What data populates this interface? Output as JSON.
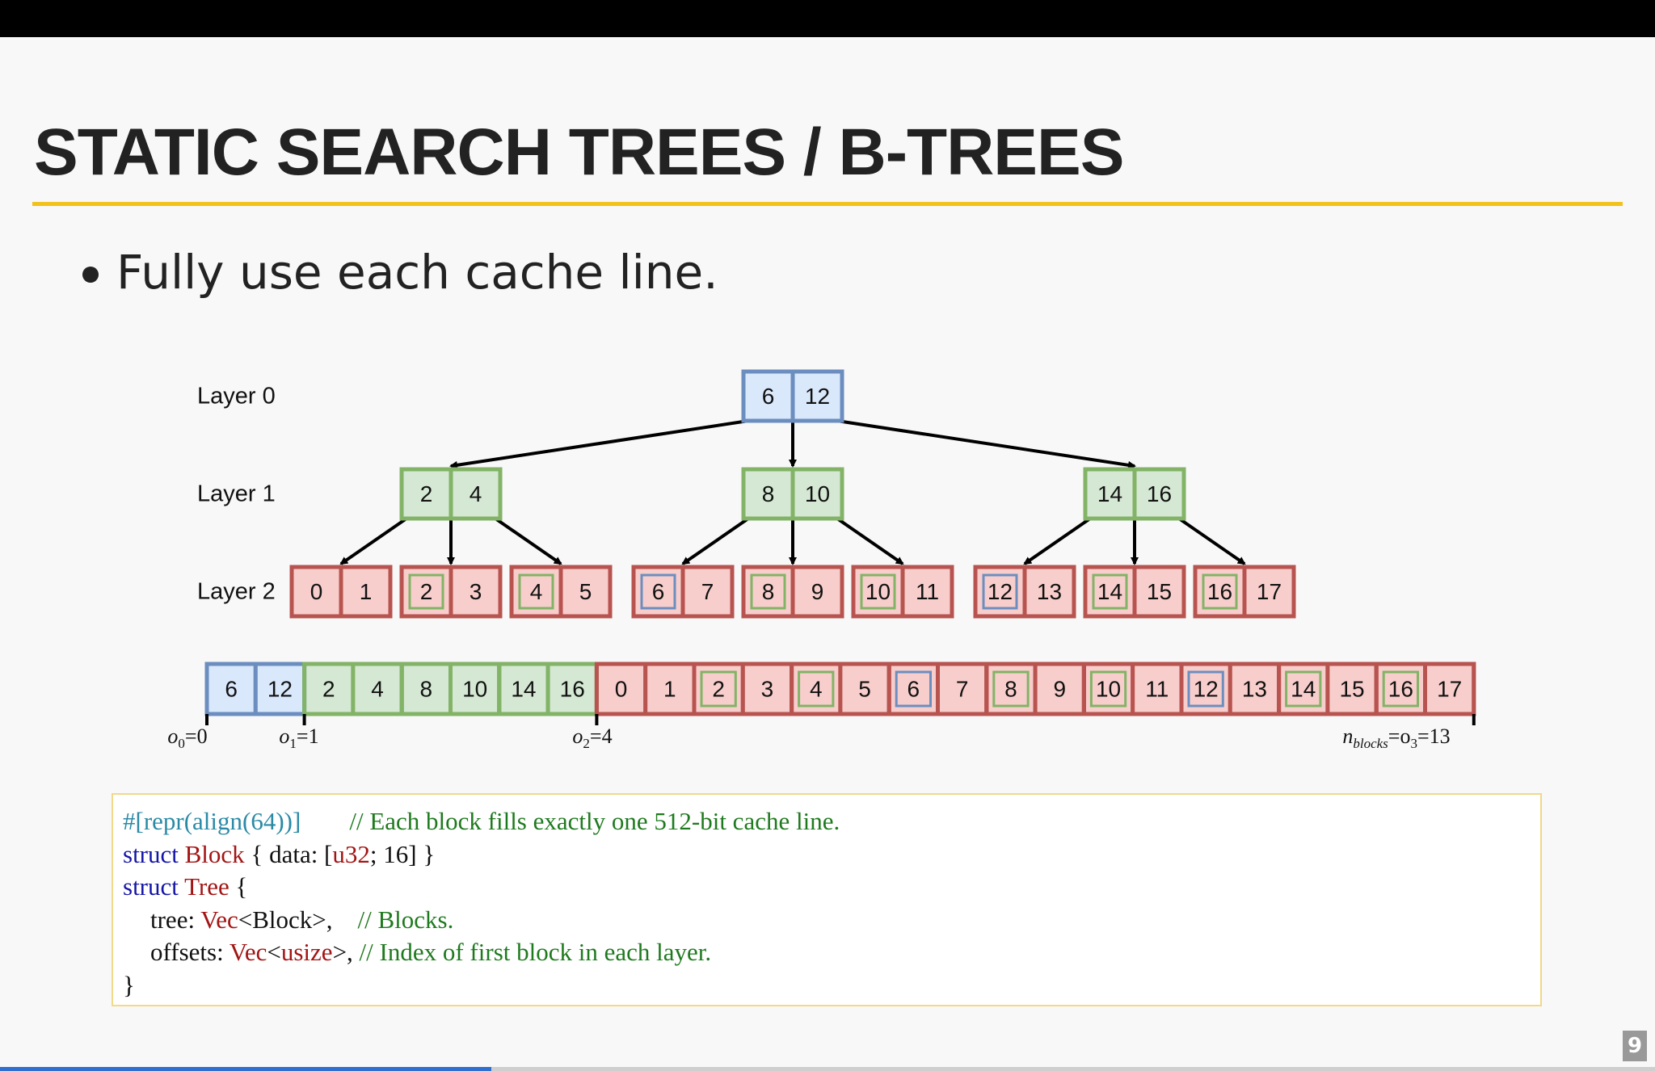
{
  "slide": {
    "title": "STATIC SEARCH TREES / B-TREES",
    "bullet": "Fully use each cache line.",
    "page_number": "9"
  },
  "diagram": {
    "layer_labels": [
      "Layer 0",
      "Layer 1",
      "Layer 2"
    ],
    "layers": [
      {
        "blocks": [
          [
            6,
            12
          ]
        ],
        "color": "blue"
      },
      {
        "blocks": [
          [
            2,
            4
          ],
          [
            8,
            10
          ],
          [
            14,
            16
          ]
        ],
        "color": "green"
      },
      {
        "blocks": [
          [
            0,
            1
          ],
          [
            2,
            3
          ],
          [
            4,
            5
          ],
          [
            6,
            7
          ],
          [
            8,
            9
          ],
          [
            10,
            11
          ],
          [
            12,
            13
          ],
          [
            14,
            15
          ],
          [
            16,
            17
          ]
        ],
        "color": "red"
      }
    ],
    "layer2_inner_highlight": [
      null,
      "green",
      "green",
      "blue",
      "green",
      "green",
      "blue",
      "green",
      "green"
    ],
    "flat_array": [
      6,
      12,
      2,
      4,
      8,
      10,
      14,
      16,
      0,
      1,
      2,
      3,
      4,
      5,
      6,
      7,
      8,
      9,
      10,
      11,
      12,
      13,
      14,
      15,
      16,
      17
    ],
    "offset_labels": [
      {
        "main": "o",
        "sub": "0",
        "rest": "=0"
      },
      {
        "main": "o",
        "sub": "1",
        "rest": "=1"
      },
      {
        "main": "o",
        "sub": "2",
        "rest": "=4"
      },
      {
        "main": "n",
        "sub": "blocks",
        "rest": "=o",
        "sub2": "3",
        "rest2": "=13"
      }
    ],
    "colors": {
      "blue_fill": "#dae8fc",
      "blue_stroke": "#6c8ebf",
      "green_fill": "#d5e8d4",
      "green_stroke": "#82b366",
      "red_fill": "#f8cecc",
      "red_stroke": "#b85450"
    }
  },
  "code": {
    "line1_attr": "#[repr(align(64))]",
    "line1_comment": "// Each block fills exactly one 512-bit cache line.",
    "line2_kw": "struct",
    "line2_name": "Block",
    "line2_a": " { data: [",
    "line2_type": "u32",
    "line2_b": "; 16] }",
    "line3_kw": "struct",
    "line3_name": "Tree",
    "line3_rest": " {",
    "line4_field": "tree: ",
    "line4_type": "Vec",
    "line4_rest": "<Block>,",
    "line4_comment": "// Blocks.",
    "line5_field": "offsets: ",
    "line5_type": "Vec",
    "line5_lt": "<",
    "line5_type2": "usize",
    "line5_rest": ">, ",
    "line5_comment": "// Index of first block in each layer.",
    "line6": "}"
  }
}
